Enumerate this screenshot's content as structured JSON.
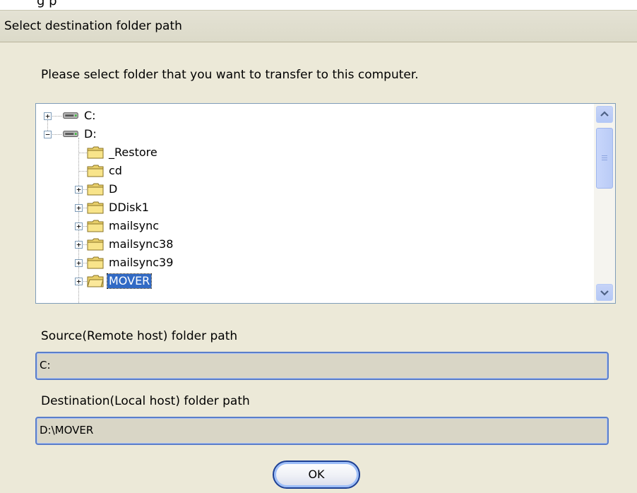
{
  "top_strip": {
    "partial_text": "g         p"
  },
  "dialog": {
    "title": "Select destination folder path",
    "instruction": "Please select folder that you want to transfer to this computer."
  },
  "tree": {
    "items": [
      {
        "label": "C:",
        "type": "drive",
        "expander": "+",
        "selected": false
      },
      {
        "label": "D:",
        "type": "drive",
        "expander": "−",
        "selected": false
      },
      {
        "label": "_Restore",
        "type": "folder",
        "expander": "",
        "selected": false
      },
      {
        "label": "cd",
        "type": "folder",
        "expander": "",
        "selected": false
      },
      {
        "label": "D",
        "type": "folder",
        "expander": "+",
        "selected": false
      },
      {
        "label": "DDisk1",
        "type": "folder",
        "expander": "+",
        "selected": false
      },
      {
        "label": "mailsync",
        "type": "folder",
        "expander": "+",
        "selected": false
      },
      {
        "label": "mailsync38",
        "type": "folder",
        "expander": "+",
        "selected": false
      },
      {
        "label": "mailsync39",
        "type": "folder",
        "expander": "+",
        "selected": false
      },
      {
        "label": "MOVER",
        "type": "folder-open",
        "expander": "+",
        "selected": true
      }
    ]
  },
  "source": {
    "label": "Source(Remote host) folder path",
    "value": "C:"
  },
  "destination": {
    "label": "Destination(Local host) folder path",
    "value": "D:\\MOVER"
  },
  "buttons": {
    "ok_label": "OK"
  },
  "icons": {
    "drive": "drive-icon",
    "folder": "folder-icon",
    "folder_open": "folder-open-icon",
    "scroll_up": "chevron-up-icon",
    "scroll_down": "chevron-down-icon"
  },
  "colors": {
    "selection": "#316ac5",
    "dialog_bg": "#ece9d8",
    "field_border": "#5b7ec9",
    "button_border": "#1c3f94"
  }
}
